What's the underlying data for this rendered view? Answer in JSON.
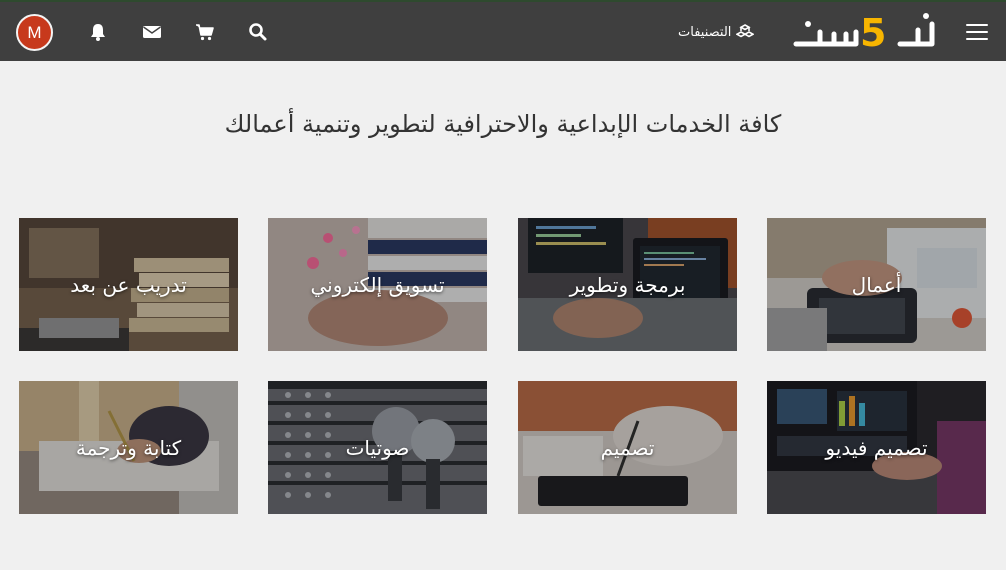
{
  "navbar": {
    "brand": "خمسات",
    "categories_label": "التصنيفات",
    "icons": [
      "menu-icon",
      "categories-icon",
      "search-icon",
      "cart-icon",
      "mail-icon",
      "bell-icon"
    ],
    "avatar_letter": "M"
  },
  "hero": {
    "title": "كافة الخدمات الإبداعية والاحترافية لتطوير وتنمية أعمالك"
  },
  "categories": [
    {
      "label": "أعمال"
    },
    {
      "label": "برمجة وتطوير"
    },
    {
      "label": "تسويق إلكتروني"
    },
    {
      "label": "تدريب عن بعد"
    },
    {
      "label": "تصميم فيديو"
    },
    {
      "label": "تصميم"
    },
    {
      "label": "صوتيات"
    },
    {
      "label": "كتابة وترجمة"
    }
  ],
  "colors": {
    "navbar_bg": "#3f3f3f",
    "page_bg": "#f0f0f0",
    "brand_accent": "#f7b500",
    "avatar_bg": "#c7391c"
  }
}
